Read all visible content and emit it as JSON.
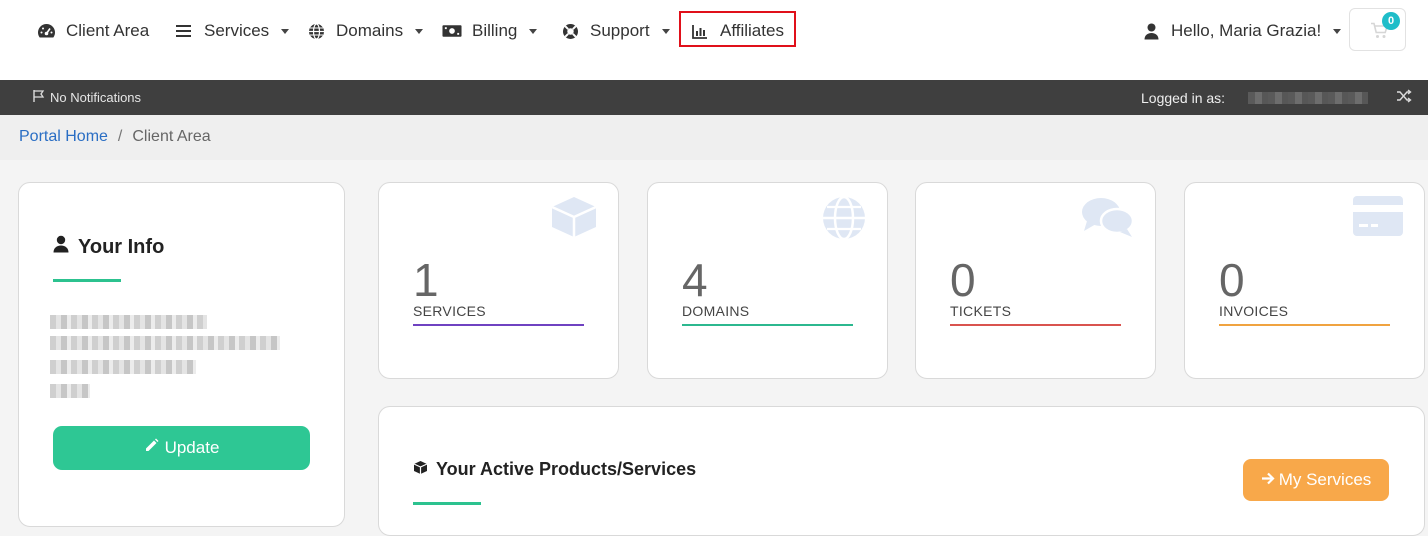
{
  "nav": {
    "client_area": "Client Area",
    "services": "Services",
    "domains": "Domains",
    "billing": "Billing",
    "support": "Support",
    "affiliates": "Affiliates",
    "user_greeting": "Hello, Maria Grazia!",
    "cart_count": "0"
  },
  "notifications": {
    "text": "No Notifications",
    "logged_in_label": "Logged in as:"
  },
  "breadcrumb": {
    "home": "Portal Home",
    "separator": "/",
    "current": "Client Area"
  },
  "your_info": {
    "title": "Your Info",
    "update_label": "Update"
  },
  "stats": [
    {
      "count": "1",
      "label": "SERVICES",
      "color": "#6f42c1",
      "icon": "box-icon"
    },
    {
      "count": "4",
      "label": "DOMAINS",
      "color": "#2cb88f",
      "icon": "globe-icon"
    },
    {
      "count": "0",
      "label": "TICKETS",
      "color": "#d9534f",
      "icon": "comments-icon"
    },
    {
      "count": "0",
      "label": "INVOICES",
      "color": "#f0a340",
      "icon": "credit-card-icon"
    }
  ],
  "products": {
    "title": "Your Active Products/Services",
    "button_label": "My Services"
  },
  "colors": {
    "accent_green": "#2ec794",
    "accent_orange": "#f8a84a",
    "link_blue": "#2a6ec4",
    "highlight_red": "#e0101a"
  }
}
